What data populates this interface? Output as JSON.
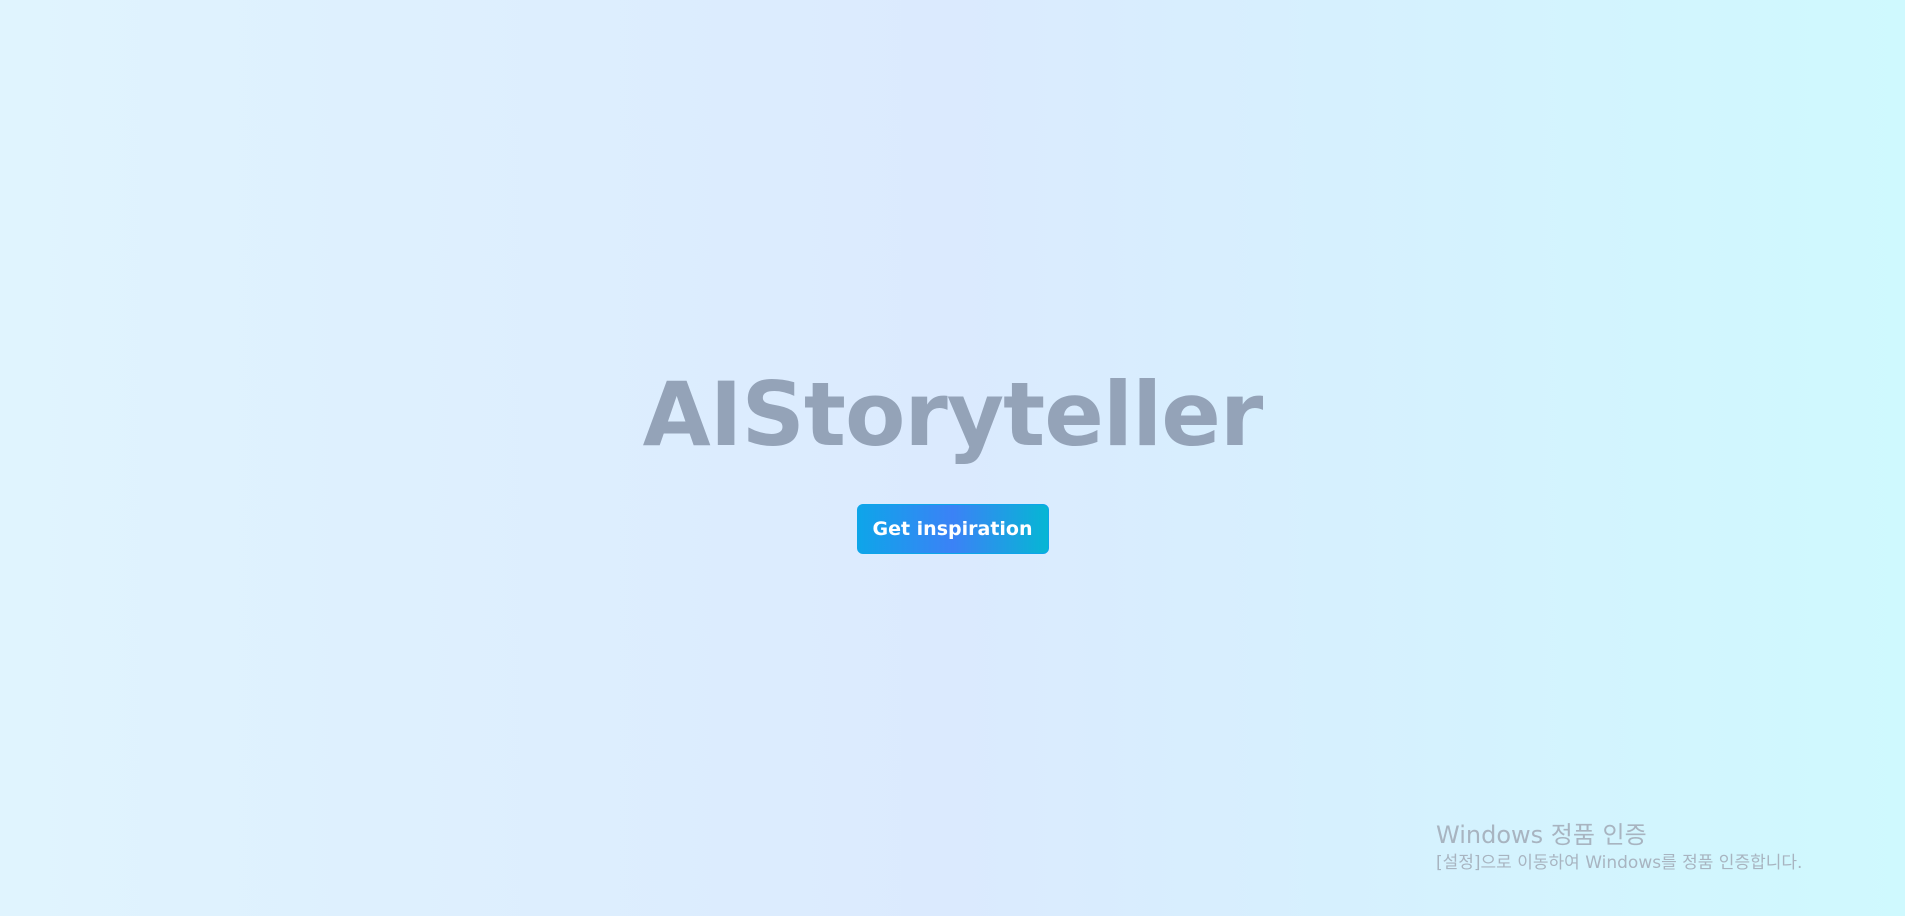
{
  "hero": {
    "title": "AIStoryteller",
    "button_label": "Get inspiration"
  },
  "watermark": {
    "title": "Windows 정품 인증",
    "subtitle": "[설정]으로 이동하여 Windows를 정품 인증합니다."
  },
  "colors": {
    "title_text": "#94a3b8",
    "button_start": "#0ea5e9",
    "button_mid": "#3b82f6",
    "button_end": "#06b6d4",
    "background_left": "#e0f4fe",
    "background_right": "#cff9fe"
  }
}
